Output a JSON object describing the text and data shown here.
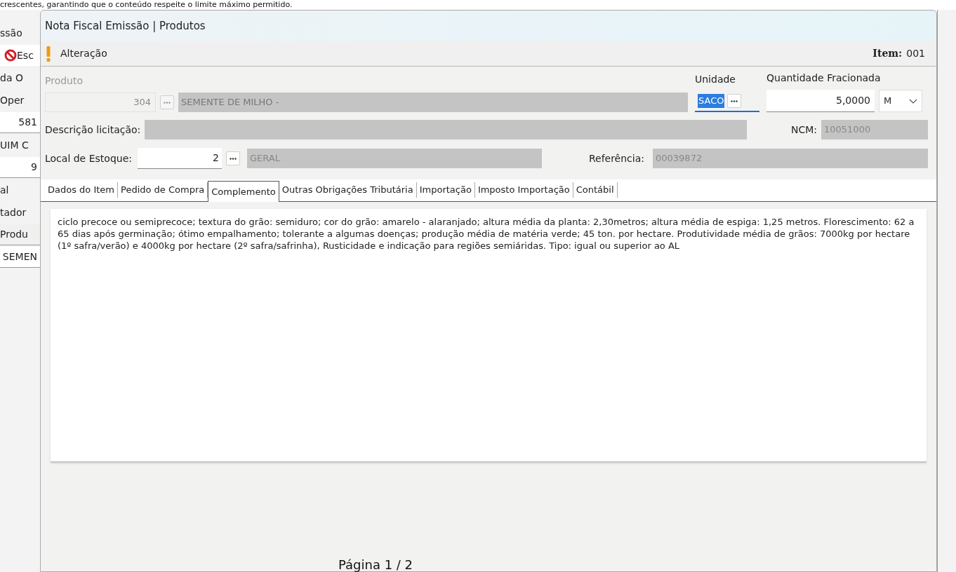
{
  "background_document": {
    "top_line": "crescentes, garantindo que o conteúdo respeite o limite máximo permitido.",
    "page_footer": "Página 1 / 2"
  },
  "background_app": {
    "items": [
      {
        "text": "ssão",
        "kind": "label"
      },
      {
        "text": "Esc",
        "kind": "button"
      },
      {
        "text": "da O",
        "kind": "label"
      },
      {
        "text": "Oper",
        "kind": "label"
      },
      {
        "text": "581",
        "kind": "field"
      },
      {
        "text": "UIM C",
        "kind": "label"
      },
      {
        "text": "9",
        "kind": "field"
      },
      {
        "text": "al",
        "kind": "label"
      },
      {
        "text": "tador",
        "kind": "label"
      },
      {
        "text": "Produ",
        "kind": "header"
      },
      {
        "text": "SEMEN",
        "kind": "field"
      }
    ]
  },
  "window": {
    "title": "Nota Fiscal Emissão | Produtos"
  },
  "toolbar": {
    "mode": "Alteração",
    "item_label": "Item:",
    "item_value": "001"
  },
  "produto": {
    "label": "Produto",
    "code": "304",
    "description": "SEMENTE DE MILHO -",
    "disabled": true
  },
  "unidade": {
    "label": "Unidade",
    "value": "SACO",
    "focused": true
  },
  "quantidade": {
    "label": "Quantidade Fracionada",
    "value": "5,0000",
    "unit": "M"
  },
  "descricao_licitacao": {
    "label": "Descrição licitação:"
  },
  "ncm": {
    "label": "NCM:",
    "value": "10051000"
  },
  "local_estoque": {
    "label": "Local de Estoque:",
    "code": "2",
    "name": "GERAL"
  },
  "referencia": {
    "label": "Referência:",
    "value": "00039872"
  },
  "tabs": [
    {
      "label": "Dados do Item",
      "selected": false
    },
    {
      "label": "Pedido de Compra",
      "selected": false
    },
    {
      "label": "Complemento",
      "selected": true
    },
    {
      "label": "Outras Obrigações Tributária",
      "selected": false
    },
    {
      "label": "Importação",
      "selected": false
    },
    {
      "label": "Imposto Importação",
      "selected": false
    },
    {
      "label": "Contábil",
      "selected": false
    }
  ],
  "complemento": {
    "text": "ciclo precoce ou semiprecoce; textura do grão: semiduro; cor do grão: amarelo - alaranjado; altura média da planta: 2,30metros; altura média de espiga: 1,25 metros. Florescimento: 62 a 65 dias após germinação; ótimo empalhamento; tolerante a algumas doenças; produção média de matéria verde; 45 ton. por hectare. Produtividade média de grãos: 7000kg por hectare (1º safra/verão) e 4000kg por hectare (2º safra/safrinha), Rusticidade e indicação para regiões semiáridas. Tipo: igual ou superior ao AL"
  }
}
